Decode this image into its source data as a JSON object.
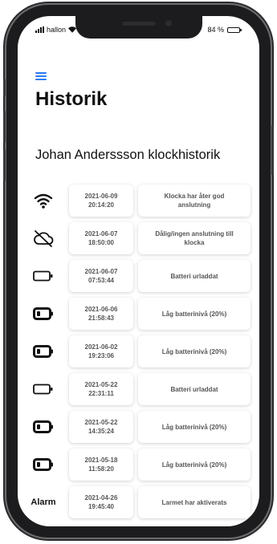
{
  "status_bar": {
    "carrier": "hallon",
    "battery_percent": "84 %"
  },
  "header": {
    "title": "Historik"
  },
  "section": {
    "title": "Johan Anderssson klockhistorik"
  },
  "history": [
    {
      "icon": "wifi-icon",
      "icon_text": "",
      "timestamp": "2021-06-09\n20:14:20",
      "message": "Klocka har åter god\nanslutning"
    },
    {
      "icon": "cloud-off-icon",
      "icon_text": "",
      "timestamp": "2021-06-07\n18:50:00",
      "message": "Dålig/ingen anslutning till\nklocka"
    },
    {
      "icon": "battery-empty-icon",
      "icon_text": "",
      "timestamp": "2021-06-07\n07:53:44",
      "message": "Batteri urladdat"
    },
    {
      "icon": "battery-low-icon",
      "icon_text": "",
      "timestamp": "2021-06-06\n21:58:43",
      "message": "Låg batterinivå (20%)"
    },
    {
      "icon": "battery-low-icon",
      "icon_text": "",
      "timestamp": "2021-06-02\n19:23:06",
      "message": "Låg batterinivå (20%)"
    },
    {
      "icon": "battery-empty-icon",
      "icon_text": "",
      "timestamp": "2021-05-22\n22:31:11",
      "message": "Batteri urladdat"
    },
    {
      "icon": "battery-low-icon",
      "icon_text": "",
      "timestamp": "2021-05-22\n14:35:24",
      "message": "Låg batterinivå (20%)"
    },
    {
      "icon": "battery-low-icon",
      "icon_text": "",
      "timestamp": "2021-05-18\n11:58:20",
      "message": "Låg batterinivå (20%)"
    },
    {
      "icon": "alarm-label",
      "icon_text": "Alarm",
      "timestamp": "2021-04-26\n19:45:40",
      "message": "Larmet har aktiverats"
    }
  ]
}
